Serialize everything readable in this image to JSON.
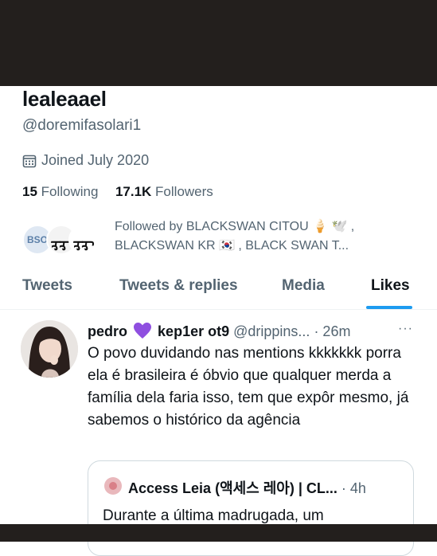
{
  "profile": {
    "display_name": "lealeaael",
    "handle": "@doremifasolari1",
    "joined": "Joined July 2020",
    "following_count": "15",
    "following_label": "Following",
    "followers_count": "17.1K",
    "followers_label": "Followers",
    "followed_by": "Followed by BLACKSWAN CITOU 🍦 🕊️ , BLACKSWAN KR 🇰🇷 , BLACK SWAN T...",
    "follower_avatars": [
      "BSO",
      "ᢋᢋ",
      "ᢋᢋ"
    ]
  },
  "tabs": [
    {
      "label": "Tweets"
    },
    {
      "label": "Tweets & replies"
    },
    {
      "label": "Media"
    },
    {
      "label": "Likes",
      "active": true
    }
  ],
  "tweet": {
    "author": "pedro",
    "author_suffix": "kep1er ot9",
    "handle": "@drippins...",
    "time": "· 26m",
    "more": "···",
    "text": "O povo duvidando nas mentions kkkkkkk porra ela é brasileira é óbvio que qualquer merda a família dela faria isso, tem que expôr mesmo, já sabemos o histórico da agência",
    "quote": {
      "name": "Access Leia (액세스 레아) | CL...",
      "time": "· 4h",
      "text": "Durante a última madrugada, um"
    }
  },
  "icons": {
    "calendar": "calendar-icon",
    "heart": "purple-heart-icon",
    "more": "more-icon"
  },
  "colors": {
    "accent": "#1d9bf0",
    "secondary_text": "#536471",
    "heart": "#8f4fe0",
    "frame": "#231f1d"
  }
}
